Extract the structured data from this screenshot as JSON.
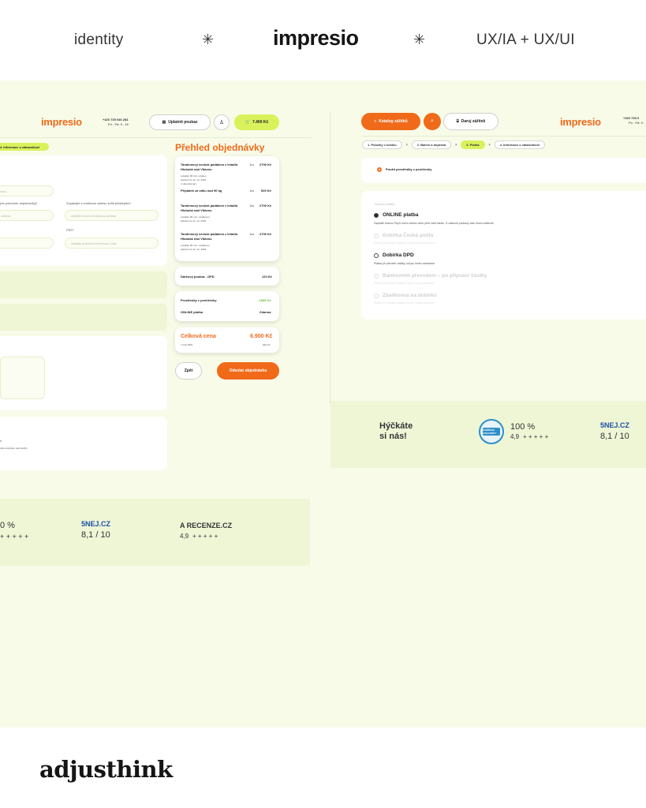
{
  "header": {
    "nav_left": "identity",
    "logo": "impresio",
    "nav_right": "UX/IA + UX/UI",
    "separator": "✳"
  },
  "left_mock": {
    "logo": "impresio",
    "phone": "+420 739 046 284",
    "hours": "Po - Pá: 9 - 16",
    "voucher_button": "Uplatnit poukaz",
    "cart_total": "7.400 Kč",
    "step_label": "4. Informace o zákazníkovi",
    "fields": {
      "name_placeholder": "méno",
      "email_label": "(ne potvrzení objednávky)*",
      "email_placeholder": "u adresu",
      "email2_label": "Zopakujte e-mailovou adresu kvůli překlepům*",
      "email2_placeholder": "zadejte znovu emailovou adresu",
      "psc_label": "PSČ*",
      "psc_placeholder": "zadejte poštovní směrovací číslo"
    },
    "bottom_note_1": "s",
    "bottom_note_2": "ného doplnění vaší služby.",
    "overview": {
      "title": "Přehled objednávky",
      "items": [
        {
          "title": "Tandemový seskok padákem z letadla Hlubuká nad Vltavou",
          "qty": "1ks",
          "price": "2700 Kč",
          "detail_1": "Lokalita: 80 min. Hradec",
          "detail_2": "platnost do 12. 12. 2023",
          "detail_3": "s videozáznam"
        },
        {
          "title": "Tandemový seskok padákem z letadla Hlubuká nad Vltavou",
          "qty": "1ks",
          "price": "2700 Kč",
          "detail_1": "Lokalita: 80 min. Lanškroun",
          "detail_2": "platnost do 12. 12. 2023"
        },
        {
          "title": "Tandemový seskok padákem z letadla Hlubuká nad Vltavou",
          "qty": "1ks",
          "price": "2700 Kč",
          "detail_1": "Lokalita: 80 min. Lanškroun",
          "detail_2": "platnost do 12. 12. 2023"
        }
      ],
      "surcharge_label": "Příplatek za váhu nad 90 kg",
      "surcharge_qty": "1ks",
      "surcharge_price": "600 Kč",
      "shipping_label": "Dárkový poukaz - DPD",
      "shipping_price": "120 Kč",
      "funds_label": "Prostředky z peněženky",
      "funds_value": "- 1800 Kč",
      "payment_label": "ONLINE platba",
      "payment_value": "Zdarma",
      "total_label": "Celková cena",
      "total_value": "6.900 Kč",
      "vat_label": "z toho DPH",
      "vat_value": "920 Kč",
      "back_button": "Zpět",
      "submit_button": "Odeslat objednávku"
    }
  },
  "right_mock": {
    "catalog_button": "Katalog zážitků",
    "gift_button": "Daruj zážitek",
    "logo": "impresio",
    "phone": "+420 739 0",
    "hours": "Po - Pá: 9 -",
    "steps": [
      "1. Položky v košíku",
      "2. Balení a doprava",
      "3. Platba",
      "4. Informace o zákazníkovi"
    ],
    "wallet_option": "Použít prostředky z peněženky",
    "payment_section": "Způsob platby",
    "options": [
      {
        "title": "ONLINE platba",
        "desc": "Zaplaťte bránou PayU mimo kartou nebo přes Vaši banku. E-mailové poukazy vám ihned zašleme.",
        "state": "checked"
      },
      {
        "title": "Dobírka Česká pošta",
        "desc": "Platba při převzetí zásilky, Kurýrní firmou doručení",
        "state": "muted"
      },
      {
        "title": "Dobírka DPD",
        "desc": "Platba při převzetí zásilky, kurýru ihned odesláme.",
        "state": "normal"
      },
      {
        "title": "Bankovním převodem – po připsání částky",
        "desc": "Platba při převzetí zásilky, kurýru ihned odesláme.",
        "state": "muted"
      },
      {
        "title": "Zásilkovna na dobírku",
        "desc": "Platba při převzetí zásilky, kurýru ihned odesláme.",
        "state": "muted"
      }
    ]
  },
  "ratings_left": {
    "percent": "0 %",
    "stars_left": "+ + + + +",
    "nej_logo": "5NEJ.CZ",
    "nej_score": "8,1 / 10",
    "recenze_logo": "A RECENZE.CZ",
    "recenze_score": "4,9",
    "recenze_stars": "+ + + + +"
  },
  "ratings_right": {
    "tagline_1": "Hýčkáte",
    "tagline_2": "si nás!",
    "badge_text": "OVĚŘENO ZÁKAZNÍKY",
    "percent": "100 %",
    "score": "4,9",
    "stars": "+ + + + +",
    "nej_logo": "5NEJ.CZ",
    "nej_score": "8,1 / 10"
  },
  "footer": {
    "brand": "adjusthink"
  },
  "colors": {
    "orange": "#f06a1a",
    "lime": "#d9f25c",
    "band": "#f8fbe8",
    "green_box": "#eef6d6"
  }
}
